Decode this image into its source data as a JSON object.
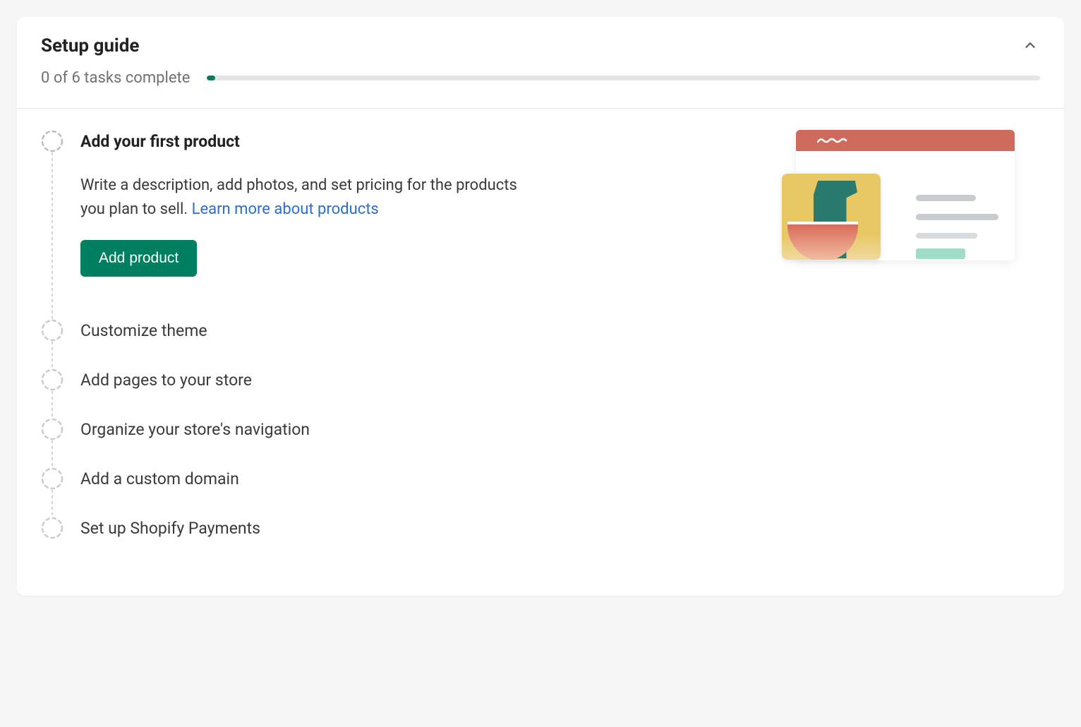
{
  "header": {
    "title": "Setup guide",
    "progress_text": "0 of 6 tasks complete",
    "completed": 0,
    "total": 6,
    "progress_percent": 1
  },
  "tasks": [
    {
      "title": "Add your first product",
      "expanded": true,
      "description": "Write a description, add photos, and set pricing for the products you plan to sell. ",
      "learn_link_text": "Learn more about products",
      "action_label": "Add product"
    },
    {
      "title": "Customize theme",
      "expanded": false
    },
    {
      "title": "Add pages to your store",
      "expanded": false
    },
    {
      "title": "Organize your store's navigation",
      "expanded": false
    },
    {
      "title": "Add a custom domain",
      "expanded": false
    },
    {
      "title": "Set up Shopify Payments",
      "expanded": false
    }
  ],
  "colors": {
    "primary": "#008060",
    "link": "#2c6ecb"
  }
}
